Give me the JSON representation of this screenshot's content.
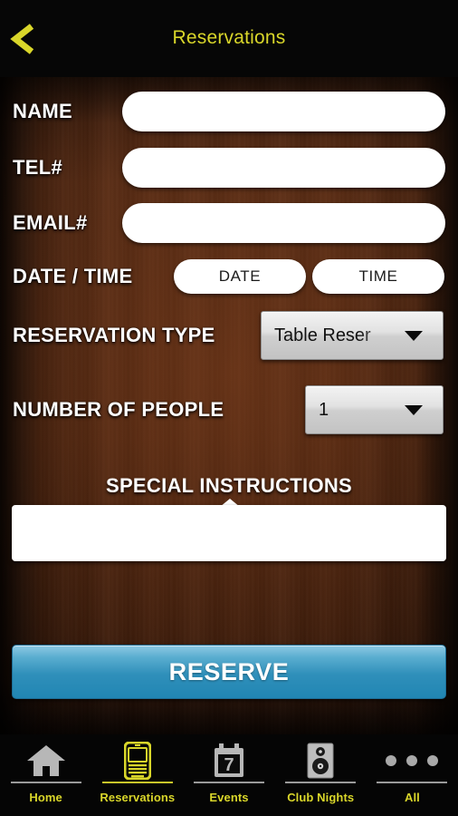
{
  "header": {
    "title": "Reservations",
    "back_icon": "chevron-left-icon",
    "accent_color": "#d9d62a",
    "background_color": "#060606"
  },
  "form": {
    "fields": [
      {
        "label": "NAME",
        "value": "",
        "placeholder": ""
      },
      {
        "label": "TEL#",
        "value": "",
        "placeholder": ""
      },
      {
        "label": "EMAIL#",
        "value": "",
        "placeholder": ""
      }
    ],
    "date_time": {
      "label": "DATE / TIME",
      "date_button": "DATE",
      "time_button": "TIME"
    },
    "reservation_type": {
      "label": "RESERVATION TYPE",
      "selected": "Table Reser",
      "arrow_icon": "chevron-down-icon"
    },
    "number_of_people": {
      "label": "NUMBER OF PEOPLE",
      "selected": "1",
      "arrow_icon": "chevron-down-icon"
    },
    "special_instructions": {
      "label": "SPECIAL INSTRUCTIONS",
      "value": "",
      "placeholder": ""
    },
    "submit": {
      "label": "RESERVE",
      "color": "#2f8fba"
    }
  },
  "tabbar": {
    "items": [
      {
        "label": "Home",
        "icon": "home-icon",
        "active": false
      },
      {
        "label": "Reservations",
        "icon": "phone-icon",
        "active": true
      },
      {
        "label": "Events",
        "icon": "calendar-icon",
        "active": false
      },
      {
        "label": "Club Nights",
        "icon": "speaker-icon",
        "active": false
      },
      {
        "label": "All",
        "icon": "more-dots-icon",
        "active": false
      }
    ]
  }
}
